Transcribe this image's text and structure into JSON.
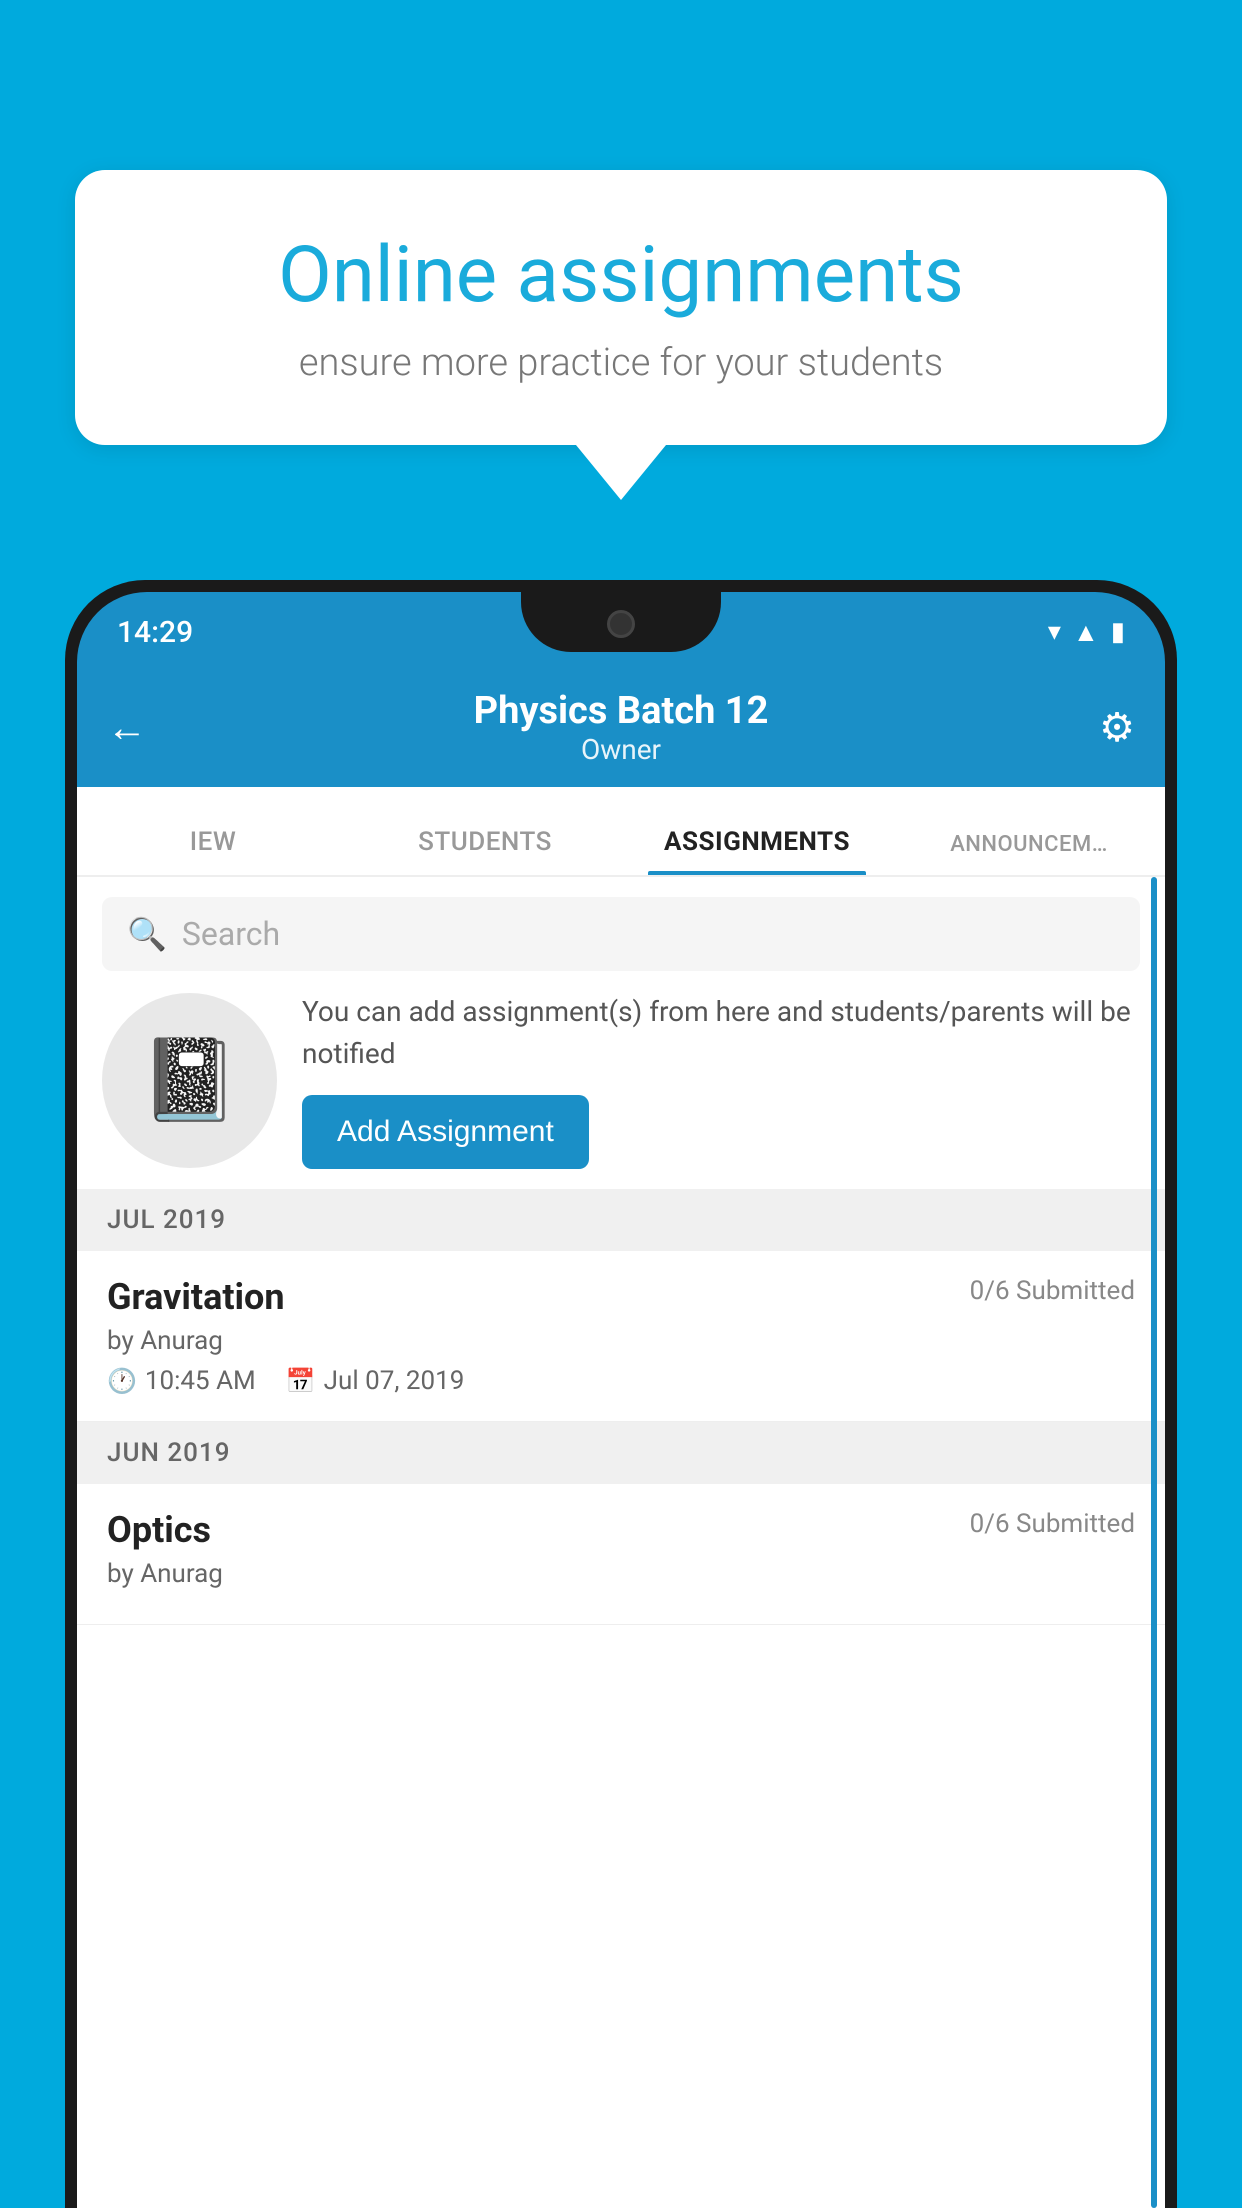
{
  "background": {
    "color": "#00AADD"
  },
  "speech_bubble": {
    "title": "Online assignments",
    "subtitle": "ensure more practice for your students"
  },
  "phone": {
    "status_bar": {
      "time": "14:29",
      "wifi_icon": "wifi",
      "signal_icon": "signal",
      "battery_icon": "battery"
    },
    "header": {
      "title": "Physics Batch 12",
      "subtitle": "Owner",
      "back_label": "←",
      "settings_label": "⚙"
    },
    "tabs": [
      {
        "label": "IEW",
        "active": false
      },
      {
        "label": "STUDENTS",
        "active": false
      },
      {
        "label": "ASSIGNMENTS",
        "active": true
      },
      {
        "label": "ANNOUNCEM…",
        "active": false
      }
    ],
    "search": {
      "placeholder": "Search"
    },
    "info_card": {
      "text": "You can add assignment(s) from here and students/parents will be notified",
      "button_label": "Add Assignment"
    },
    "sections": [
      {
        "label": "JUL 2019",
        "assignments": [
          {
            "title": "Gravitation",
            "submitted": "0/6 Submitted",
            "by": "by Anurag",
            "time": "10:45 AM",
            "date": "Jul 07, 2019"
          }
        ]
      },
      {
        "label": "JUN 2019",
        "assignments": [
          {
            "title": "Optics",
            "submitted": "0/6 Submitted",
            "by": "by Anurag",
            "time": "",
            "date": ""
          }
        ]
      }
    ]
  }
}
